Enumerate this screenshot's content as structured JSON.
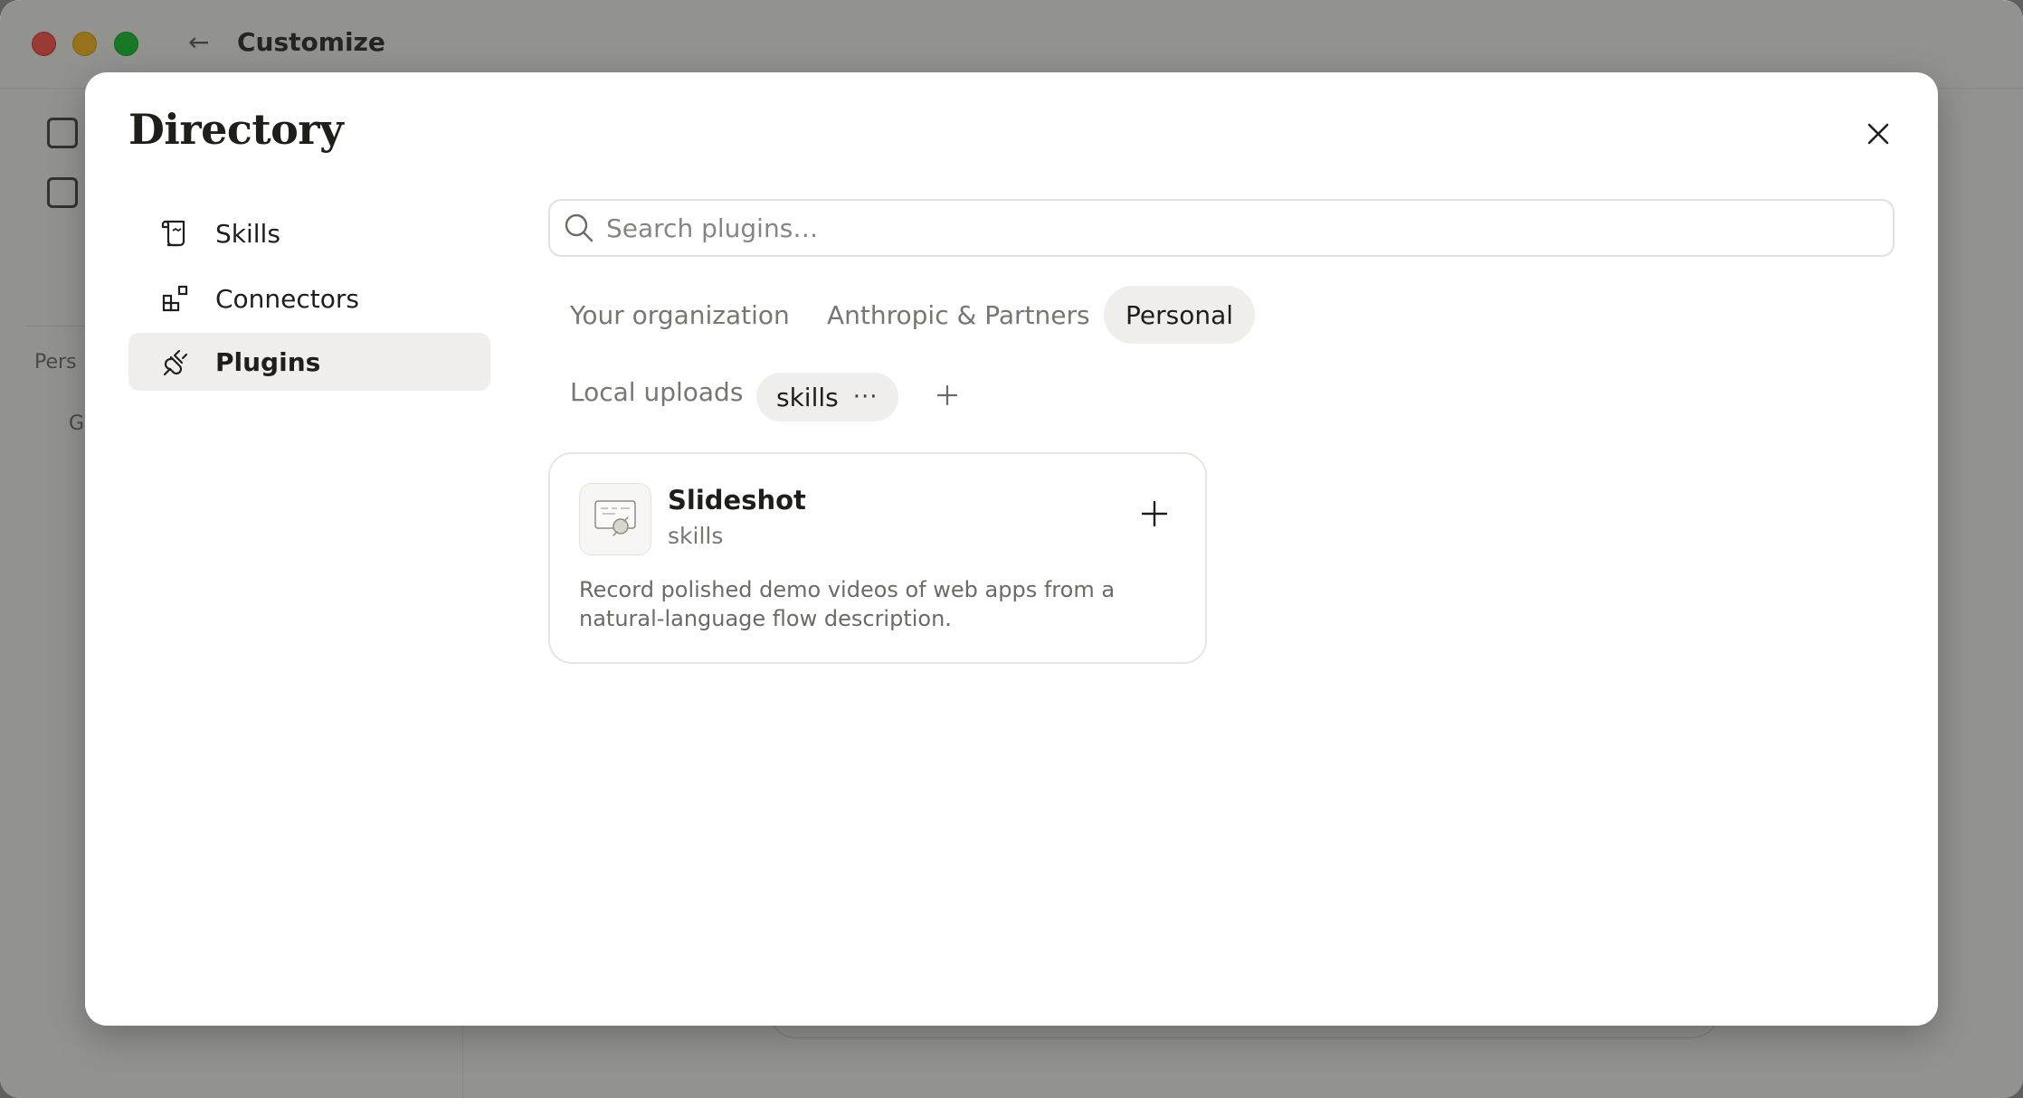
{
  "window": {
    "title": "Customize",
    "back_icon": "arrow-left-icon"
  },
  "background": {
    "section_label": "Pers",
    "section_item": "G"
  },
  "modal": {
    "title": "Directory",
    "close_icon": "close-icon"
  },
  "sidebar": {
    "items": [
      {
        "label": "Skills",
        "icon": "scroll-icon",
        "active": false
      },
      {
        "label": "Connectors",
        "icon": "connectors-icon",
        "active": false
      },
      {
        "label": "Plugins",
        "icon": "plug-icon",
        "active": true
      }
    ]
  },
  "search": {
    "placeholder": "Search plugins…",
    "value": ""
  },
  "tabs": [
    {
      "label": "Your organization",
      "active": false
    },
    {
      "label": "Anthropic & Partners",
      "active": false
    },
    {
      "label": "Personal",
      "active": true
    }
  ],
  "filters": {
    "source_label": "Local uploads",
    "chip_label": "skills",
    "chip_more": "···",
    "add_icon": "plus-icon"
  },
  "plugins": [
    {
      "name": "Slideshot",
      "category": "skills",
      "description": "Record polished demo videos of web apps from a natural-language flow description.",
      "icon": "slideshot-thumbnail-icon",
      "add_icon": "plus-icon"
    }
  ],
  "colors": {
    "accent_surface": "#efeeea",
    "text_primary": "#1f1e1b",
    "text_muted": "#78766f"
  }
}
